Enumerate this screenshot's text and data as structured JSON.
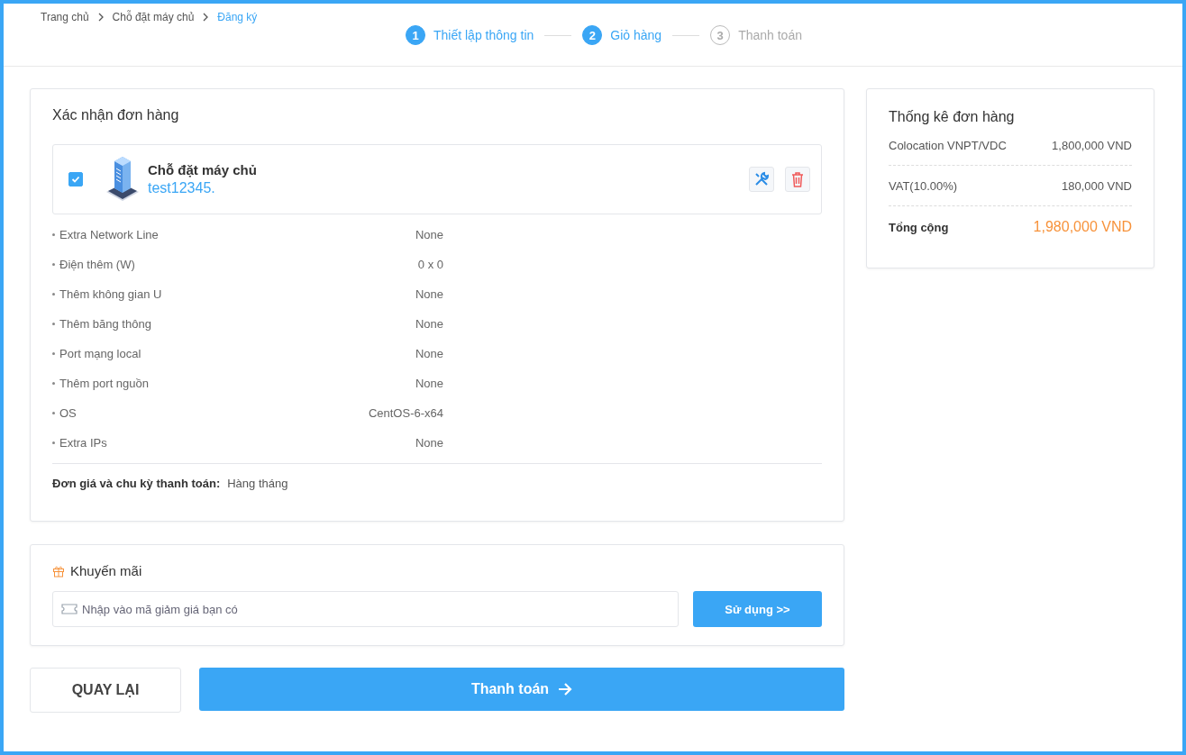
{
  "breadcrumb": [
    {
      "label": "Trang chủ",
      "current": false
    },
    {
      "label": "Chỗ đặt máy chủ",
      "current": false
    },
    {
      "label": "Đăng ký",
      "current": true
    }
  ],
  "steps": [
    {
      "number": "1",
      "label": "Thiết lập thông tin",
      "reached": true
    },
    {
      "number": "2",
      "label": "Giỏ hàng",
      "reached": true
    },
    {
      "number": "3",
      "label": "Thanh toán",
      "reached": false
    }
  ],
  "order": {
    "title": "Xác nhận đơn hàng",
    "item": {
      "checked": true,
      "name": "Chỗ đặt máy chủ",
      "hostname": "test12345."
    },
    "options": [
      {
        "label": "Extra Network Line",
        "value": "None"
      },
      {
        "label": "Điện thêm (W)",
        "value": "0 x 0"
      },
      {
        "label": "Thêm không gian U",
        "value": "None"
      },
      {
        "label": "Thêm băng thông",
        "value": "None"
      },
      {
        "label": "Port mạng local",
        "value": "None"
      },
      {
        "label": "Thêm port nguồn",
        "value": "None"
      },
      {
        "label": "OS",
        "value": "CentOS-6-x64"
      },
      {
        "label": "Extra IPs",
        "value": "None"
      }
    ],
    "billing_label": "Đơn giá và chu kỳ thanh toán:",
    "billing_value": "Hàng tháng"
  },
  "promo": {
    "title": "Khuyến mãi",
    "placeholder": "Nhập vào mã giảm giá bạn có",
    "apply_button": "Sử dụng >>"
  },
  "back_button": "QUAY LẠI",
  "pay_button": "Thanh toán",
  "summary": {
    "title": "Thống kê đơn hàng",
    "lines": [
      {
        "label": "Colocation VNPT/VDC",
        "value": "1,800,000 VND"
      },
      {
        "label": "VAT(10.00%)",
        "value": "180,000 VND"
      }
    ],
    "total_label": "Tổng cộng",
    "total_value": "1,980,000 VND"
  }
}
